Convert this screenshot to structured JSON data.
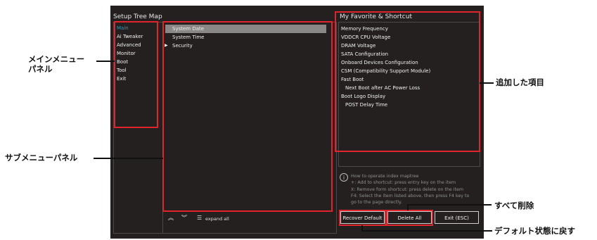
{
  "setup_tree": {
    "title": "Setup Tree Map",
    "menu": [
      "Main",
      "Ai Tweaker",
      "Advanced",
      "Monitor",
      "Boot",
      "Tool",
      "Exit"
    ],
    "active_color": "#1aa3c8"
  },
  "submenu": {
    "items": [
      "System Date",
      "System Time",
      "Security"
    ],
    "selected_index": 0,
    "expand_all_label": "expand all"
  },
  "favorites": {
    "title": "My Favorite & Shortcut",
    "items": [
      "Memory Frequency",
      "VDDCR CPU Voltage",
      "DRAM Voltage",
      "SATA Configuration",
      "Onboard Devices Configuration",
      "CSM (Compatibility Support Module)",
      "Fast Boot",
      "Next Boot after AC Power Loss",
      "Boot Logo Display",
      "POST Delay Time"
    ]
  },
  "help": {
    "line1": "How to operate index maptree",
    "line2": "+: Add to shortcut: press entry key on the item",
    "line3": "X: Remove form shortcut: press delete on the item",
    "line4": "F4: Select the item listed above, then press F4 key to",
    "line5": "go to the page directly."
  },
  "buttons": {
    "recover": "Recover Default",
    "delete_all": "Delete All",
    "exit": "Exit (ESC)"
  },
  "annotations": {
    "main_menu_1": "メインメニュー",
    "main_menu_2": "パネル",
    "submenu": "サブメニューパネル",
    "added_items": "追加した項目",
    "delete_all": "すべて削除",
    "restore_default": "デフォルト状態に戻す"
  },
  "colors": {
    "screen_bg": "#24201f",
    "highlight_red": "#e0242c"
  }
}
